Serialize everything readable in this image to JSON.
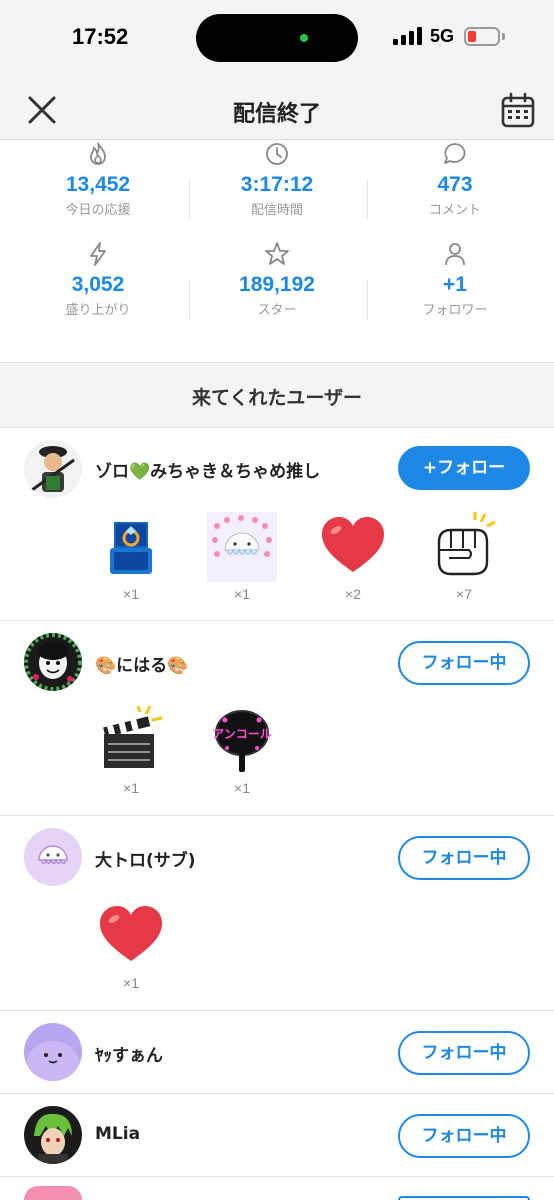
{
  "status_bar": {
    "time": "17:52",
    "network": "5G"
  },
  "nav": {
    "title": "配信終了"
  },
  "stats": [
    {
      "icon": "flame-icon",
      "value": "13,452",
      "label": "今日の応援"
    },
    {
      "icon": "clock-icon",
      "value": "3:17:12",
      "label": "配信時間"
    },
    {
      "icon": "comment-icon",
      "value": "473",
      "label": "コメント"
    },
    {
      "icon": "lightning-icon",
      "value": "3,052",
      "label": "盛り上がり"
    },
    {
      "icon": "star-icon",
      "value": "189,192",
      "label": "スター"
    },
    {
      "icon": "person-icon",
      "value": "+1",
      "label": "フォロワー"
    }
  ],
  "section_title": "来てくれたユーザー",
  "users": [
    {
      "name": "ゾロ💚みちゃき＆ちゃめ推し",
      "follow_label": "+フォロー",
      "gifts": [
        {
          "icon": "ring-box-icon",
          "count": "×1"
        },
        {
          "icon": "jellyfish-icon",
          "count": "×1"
        },
        {
          "icon": "heart-icon",
          "count": "×2"
        },
        {
          "icon": "fist-icon",
          "count": "×7"
        }
      ]
    },
    {
      "name": "🎨にはる🎨",
      "follow_label": "フォロー中",
      "gifts": [
        {
          "icon": "clapperboard-icon",
          "count": "×1"
        },
        {
          "icon": "uchiwa-fan-icon",
          "count": "×1"
        }
      ]
    },
    {
      "name": "大トロ(サブ)",
      "follow_label": "フォロー中",
      "gifts": [
        {
          "icon": "heart-icon",
          "count": "×1"
        }
      ]
    },
    {
      "name": "ﾔｯすぁん",
      "follow_label": "フォロー中",
      "gifts": []
    },
    {
      "name": "MLia",
      "follow_label": "フォロー中",
      "gifts": []
    }
  ],
  "colors": {
    "accent": "#1e88e5",
    "heart": "#e53945",
    "background": "#f4f4f6"
  }
}
